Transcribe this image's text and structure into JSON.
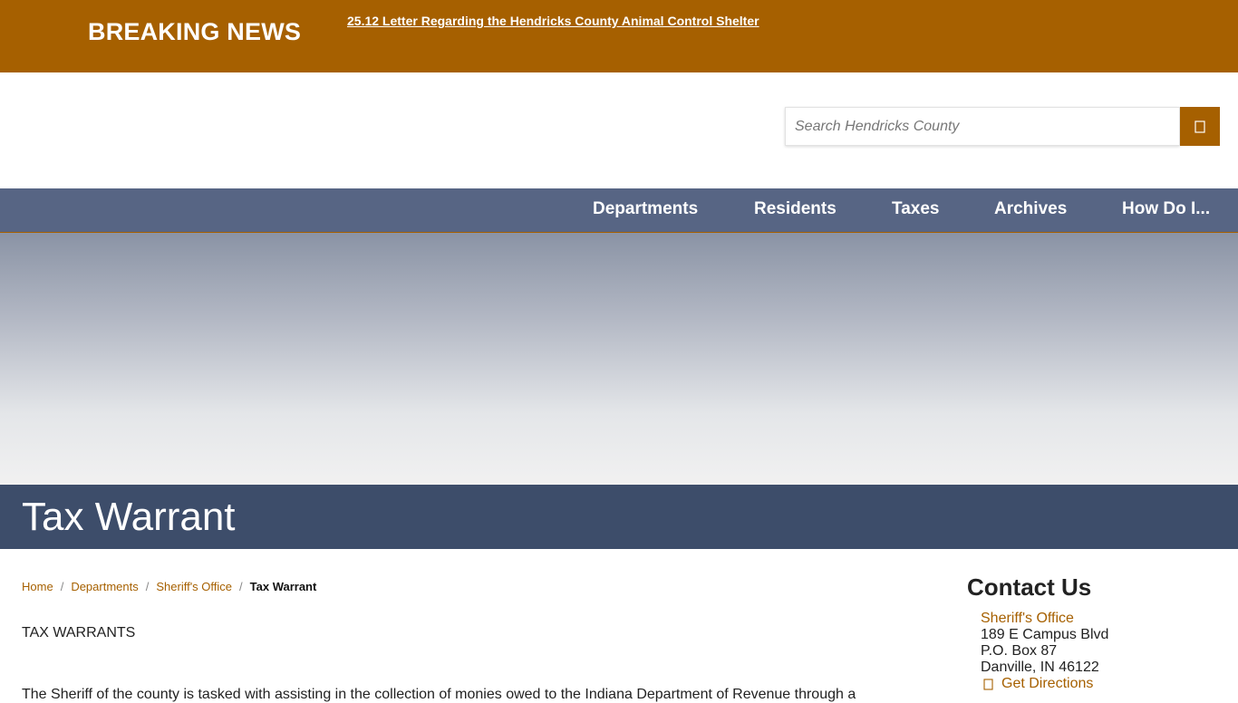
{
  "breaking": {
    "title": "BREAKING NEWS",
    "link_text": "25.12 Letter Regarding the Hendricks County Animal Control Shelter"
  },
  "search": {
    "placeholder": "Search Hendricks County",
    "button_icon": "search-icon"
  },
  "nav": {
    "items": [
      {
        "label": "Departments"
      },
      {
        "label": "Residents"
      },
      {
        "label": "Taxes"
      },
      {
        "label": "Archives"
      },
      {
        "label": "How Do I..."
      }
    ]
  },
  "page": {
    "title": "Tax Warrant"
  },
  "breadcrumb": {
    "items": [
      {
        "label": "Home"
      },
      {
        "label": "Departments"
      },
      {
        "label": "Sheriff's Office"
      }
    ],
    "current": "Tax Warrant"
  },
  "content": {
    "heading": "TAX WARRANTS",
    "body": "The Sheriff of the county is tasked with assisting in the collection of monies owed to the Indiana Department of Revenue through a"
  },
  "contact": {
    "title": "Contact Us",
    "office": "Sheriff's Office",
    "address1": "189 E Campus Blvd",
    "address2": "P.O. Box 87",
    "address3": "Danville, IN 46122",
    "directions": "Get Directions",
    "directions_icon": "map-marker-icon"
  },
  "colors": {
    "brand_orange": "#a66000",
    "nav_blue": "#576584",
    "title_bar": "#3d4d6a"
  }
}
